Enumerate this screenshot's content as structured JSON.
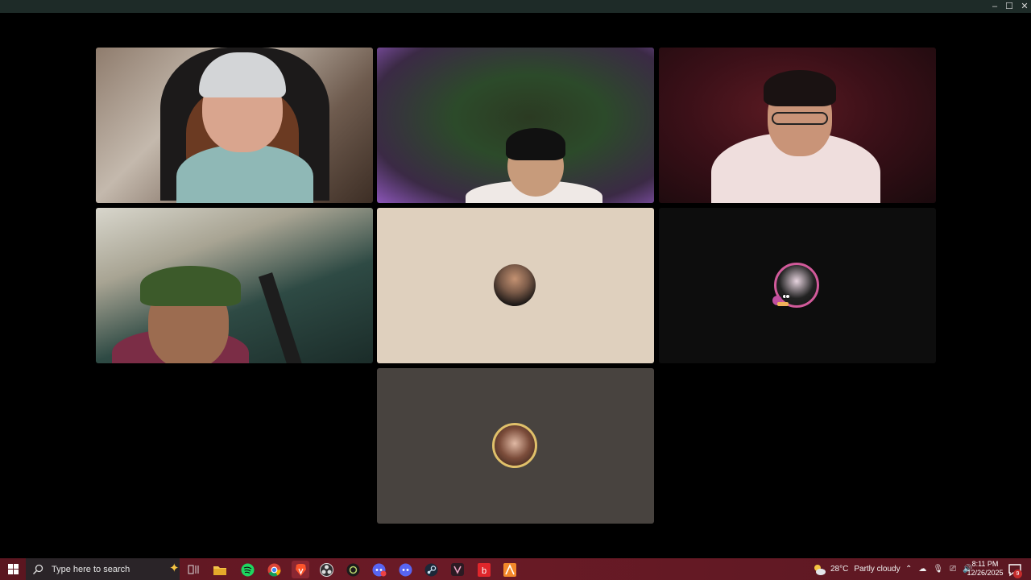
{
  "window": {
    "minimize_icon": "minimize-icon",
    "maximize_icon": "maximize-icon",
    "close_icon": "close-icon",
    "min_glyph": "–",
    "max_glyph": "☐",
    "close_glyph": "✕"
  },
  "tiles": [
    {
      "kind": "video",
      "colors": {
        "bg": "#8f7c6d"
      }
    },
    {
      "kind": "video",
      "colors": {
        "bg": "#2c4a2a"
      }
    },
    {
      "kind": "video",
      "colors": {
        "bg": "#3b1018"
      }
    },
    {
      "kind": "video",
      "colors": {
        "bg": "#2e4a44"
      }
    },
    {
      "kind": "avatar",
      "colors": {
        "bg": "#dfd0be"
      }
    },
    {
      "kind": "avatar",
      "colors": {
        "bg": "#0d0d0d",
        "ring": "#d15a9a"
      }
    },
    {
      "kind": "avatar",
      "colors": {
        "bg": "#48433f",
        "ring": "#e0c06a"
      }
    }
  ],
  "taskbar": {
    "search_placeholder": "Type here to search",
    "apps": [
      "task-view-icon",
      "file-explorer-icon",
      "spotify-icon",
      "chrome-icon",
      "brave-icon",
      "obs-icon",
      "app-icon",
      "discord-notification-icon",
      "discord-icon",
      "steam-icon",
      "vivaldi-icon",
      "app-red-icon",
      "app-orange-icon"
    ],
    "weather": {
      "temp": "28°C",
      "condition": "Partly cloudy"
    },
    "clock": {
      "time": "8:11 PM",
      "date": "12/26/2025"
    },
    "notification_count": "9"
  },
  "colors": {
    "taskbar": "#6b1a26",
    "titlebar": "#1e2b28"
  }
}
